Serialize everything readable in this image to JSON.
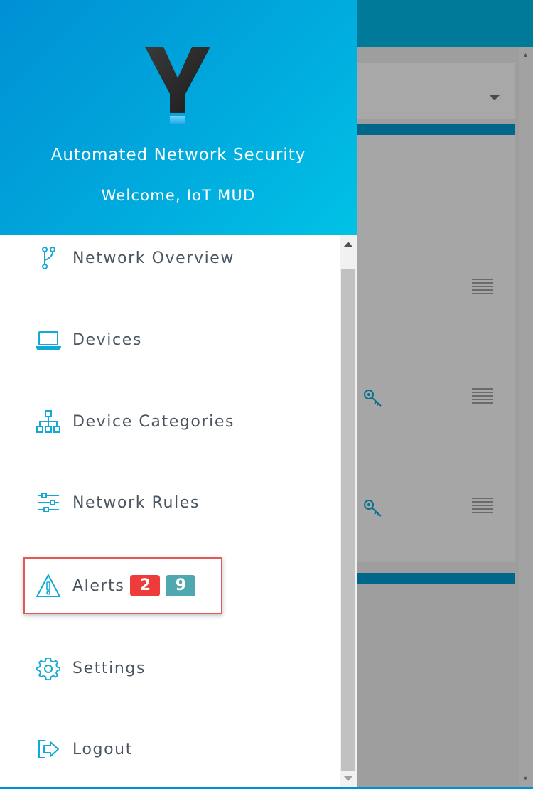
{
  "app": {
    "title": "Automated Network Security",
    "welcome": "Welcome, IoT MUD",
    "accent_color": "#00a9dd"
  },
  "menu": {
    "items": [
      {
        "label": "Network Overview",
        "icon": "network-branch-icon"
      },
      {
        "label": "Devices",
        "icon": "laptop-icon"
      },
      {
        "label": "Device Categories",
        "icon": "hierarchy-icon"
      },
      {
        "label": "Network Rules",
        "icon": "sliders-icon"
      },
      {
        "label": "Alerts",
        "icon": "warning-icon",
        "badges": [
          "2",
          "9"
        ]
      },
      {
        "label": "Settings",
        "icon": "gear-icon"
      },
      {
        "label": "Logout",
        "icon": "logout-icon"
      }
    ]
  },
  "badge_colors": {
    "critical": "#ee3b3b",
    "info": "#4fa8b0"
  }
}
